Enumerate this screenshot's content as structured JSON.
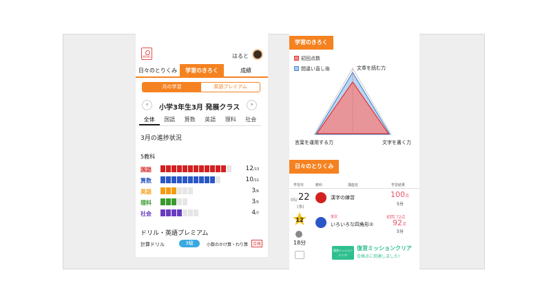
{
  "left": {
    "menu_label": "MENU",
    "username": "はると",
    "tabs": [
      "日々のとりくみ",
      "学習のきろく",
      "成績"
    ],
    "active_tab": 1,
    "segments": [
      "月の学習",
      "英語プレミアム"
    ],
    "class_title": "小学3年生3月 発展クラス",
    "prev": "‹",
    "next": "›",
    "subjects": [
      "全体",
      "国語",
      "算数",
      "英語",
      "理科",
      "社会"
    ],
    "progress_title": "3月の進捗状況",
    "group_title": "5教科",
    "rows": [
      {
        "name": "国語",
        "color": "#d32020",
        "done": 12,
        "total": 13,
        "count": "12",
        "den": "/13"
      },
      {
        "name": "算数",
        "color": "#2a56c6",
        "done": 10,
        "total": 11,
        "count": "10",
        "den": "/11"
      },
      {
        "name": "英語",
        "color": "#f39c12",
        "done": 3,
        "total": 6,
        "count": "3",
        "den": "/6"
      },
      {
        "name": "理科",
        "color": "#3a9a2e",
        "done": 3,
        "total": 5,
        "count": "3",
        "den": "/5"
      },
      {
        "name": "社会",
        "color": "#6a3cc0",
        "done": 4,
        "total": 7,
        "count": "4",
        "den": "/7"
      }
    ],
    "drill_title": "ドリル・英語プレミアム",
    "drill": {
      "label": "計算ドリル",
      "level": "3級",
      "topic": "小数のかけ算・わり算",
      "badge": "合格"
    }
  },
  "right": {
    "record_header": "学習のきろく",
    "legend_first": "初回点数",
    "legend_review": "間違い直し後",
    "legend_first_color": "#f08a8a",
    "legend_review_color": "#a9c9ee",
    "radar_labels": [
      "文章を読む力",
      "文字を書く力",
      "言葉を運用する力"
    ],
    "daily_header": "日々のとりくみ",
    "table_headers": [
      "学習日",
      "教科",
      "講座名",
      "学習結果"
    ],
    "date": "05/",
    "day": "22",
    "weekday": "(水)",
    "star_count": "12",
    "total_time": "18分",
    "lessons": [
      {
        "title": "漢字の練習",
        "score": "100",
        "unit": "点",
        "minutes": "5分",
        "icon_color": "#d32020",
        "icon_text": "こくご"
      },
      {
        "title": "いろいろな四角形②",
        "score": "92",
        "unit": "点",
        "minutes": "5分",
        "icon_color": "#2a56c6",
        "icon_text": "さんすう",
        "review_label": "復習",
        "first_label": "初回 72点"
      }
    ],
    "mission_tag": "復習ミッション クリア!",
    "mission_title": "復習ミッションクリア",
    "mission_sub": "合格点に到達しました!"
  }
}
